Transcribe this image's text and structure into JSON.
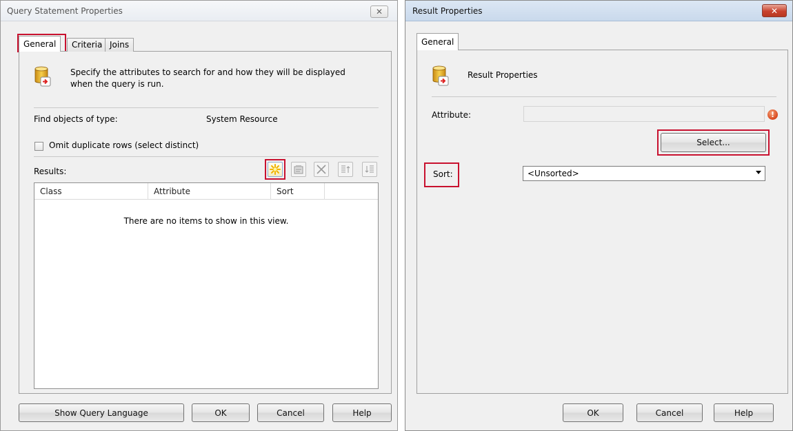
{
  "query_dialog": {
    "title": "Query Statement Properties",
    "close_glyph": "✕",
    "tabs": [
      {
        "label": "General",
        "selected": true
      },
      {
        "label": "Criteria",
        "selected": false
      },
      {
        "label": "Joins",
        "selected": false
      }
    ],
    "info_icon": "database-arrow-icon",
    "description": "Specify the attributes to search for and how they will be displayed",
    "description_line2": "when the query is run.",
    "find_label": "Find objects of type:",
    "find_value": "System Resource",
    "omit_duplicates_label": "Omit duplicate rows (select distinct)",
    "omit_duplicates_checked": false,
    "results_label": "Results:",
    "toolbar_icons": [
      "new-icon",
      "properties-icon",
      "delete-icon",
      "move-up-icon",
      "move-down-icon"
    ],
    "results_columns": [
      "Class",
      "Attribute",
      "Sort"
    ],
    "results_empty_text": "There are no items to show in this view.",
    "buttons": {
      "show_query_language": "Show Query Language",
      "ok": "OK",
      "cancel": "Cancel",
      "help": "Help"
    }
  },
  "result_dialog": {
    "title": "Result Properties",
    "close_glyph": "✕",
    "tabs": [
      {
        "label": "General",
        "selected": true
      }
    ],
    "heading": "Result Properties",
    "info_icon": "database-arrow-icon",
    "attribute_label": "Attribute:",
    "attribute_value": "",
    "warning_glyph": "!",
    "select_button": "Select...",
    "sort_label": "Sort:",
    "sort_selected": "<Unsorted>",
    "buttons": {
      "ok": "OK",
      "cancel": "Cancel",
      "help": "Help"
    }
  },
  "colors": {
    "highlight": "#c8102e",
    "close_red": "#c8422d",
    "panel_bg": "#f0f0f0"
  }
}
